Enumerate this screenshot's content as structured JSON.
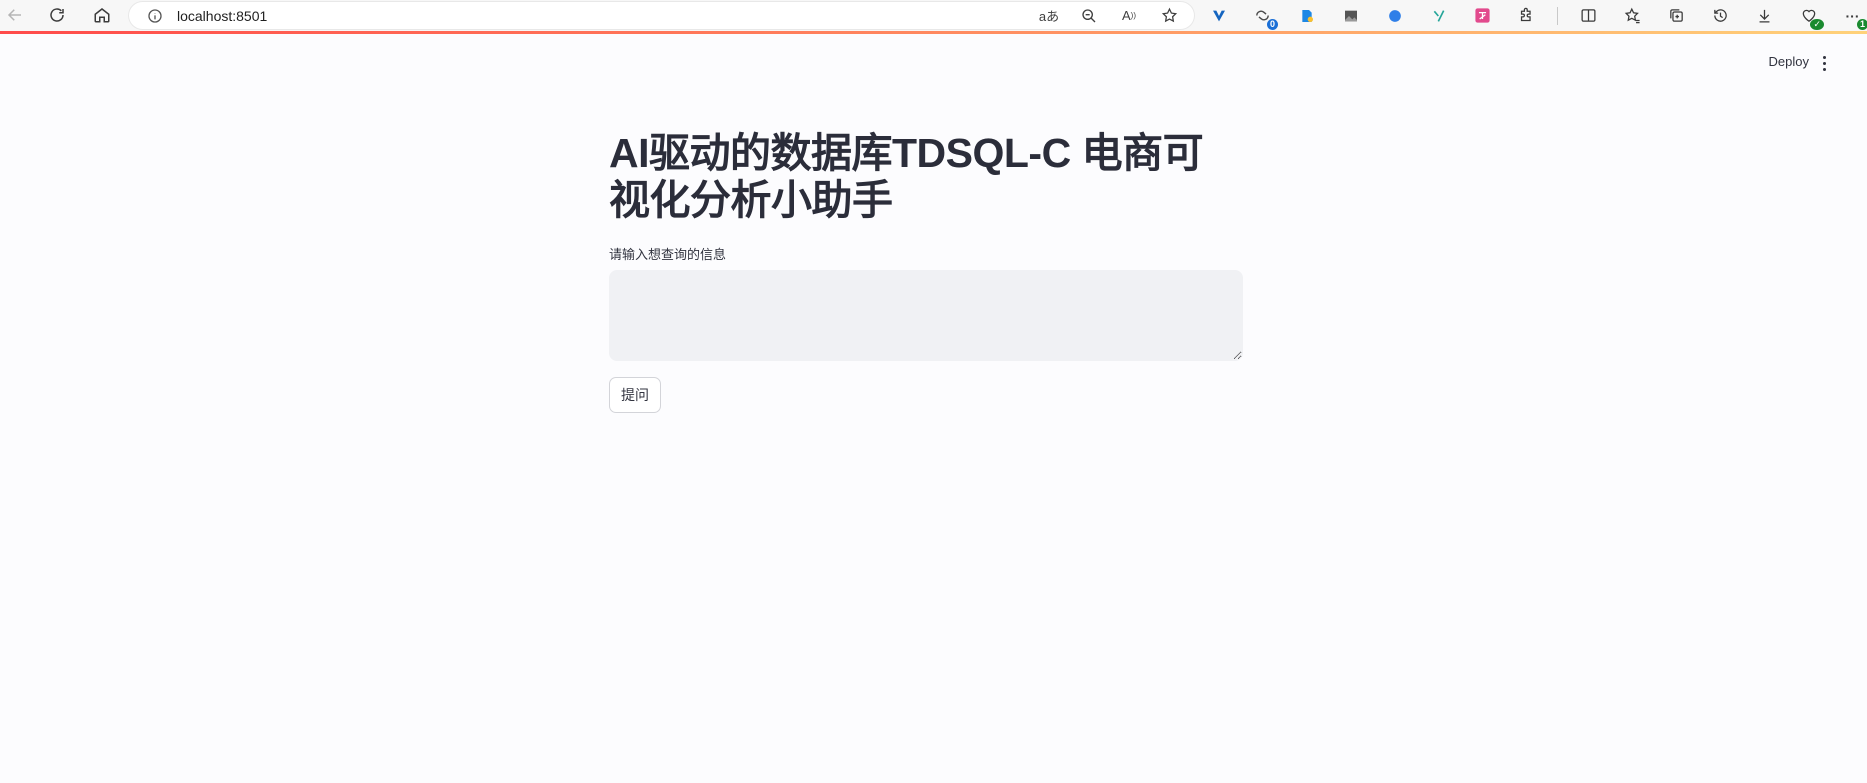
{
  "browser": {
    "url": "localhost:8501",
    "extensions": [
      {
        "name": "vpn-extension-icon"
      },
      {
        "name": "sync-extension-icon",
        "badge": "0"
      },
      {
        "name": "shopping-extension-icon"
      },
      {
        "name": "image-extension-icon"
      },
      {
        "name": "blue-dot-extension-icon"
      },
      {
        "name": "leaf-extension-icon"
      },
      {
        "name": "translate-extension-icon"
      },
      {
        "name": "puzzle-extensions-icon"
      }
    ],
    "more_badge": "1"
  },
  "app_header": {
    "deploy_label": "Deploy"
  },
  "main": {
    "title": "AI驱动的数据库TDSQL-C 电商可视化分析小助手",
    "input_label": "请输入想查询的信息",
    "input_value": "",
    "submit_label": "提问"
  },
  "colors": {
    "accent_start": "#ff4b4b",
    "accent_end": "#ffd27a",
    "input_bg": "#f0f1f4",
    "title_color": "#2b2d3a"
  }
}
